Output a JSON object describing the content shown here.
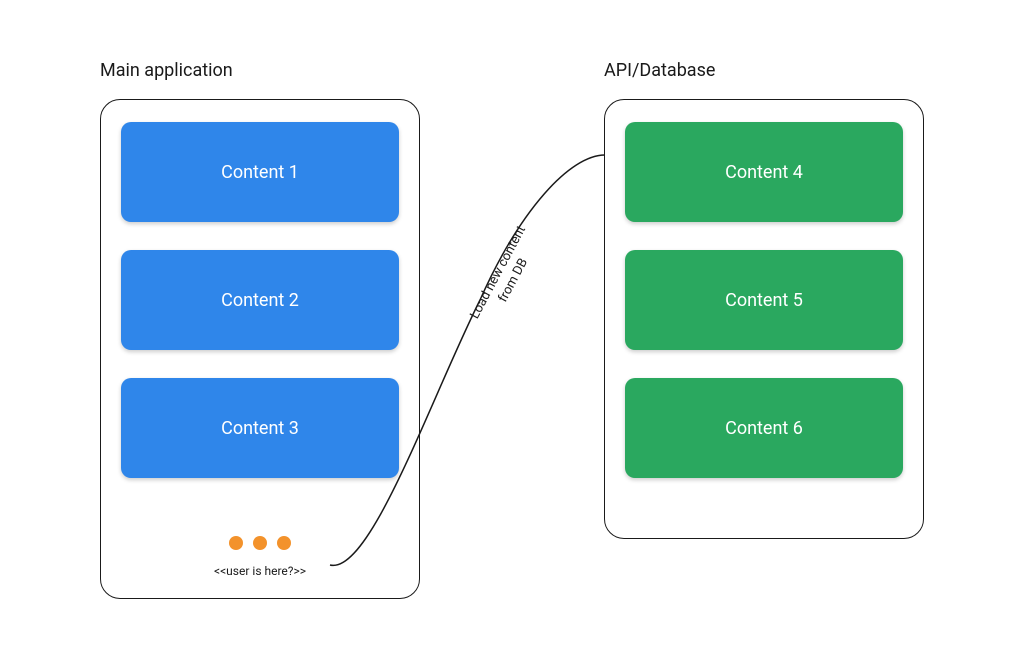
{
  "left": {
    "title": "Main application",
    "cards": [
      "Content 1",
      "Content 2",
      "Content 3"
    ],
    "user_marker": "<<user is here?>>"
  },
  "right": {
    "title": "API/Database",
    "cards": [
      "Content 4",
      "Content 5",
      "Content 6"
    ]
  },
  "connector": {
    "label_line1": "Load new content",
    "label_line2": "from DB"
  },
  "colors": {
    "blue": "#2f86ea",
    "green": "#2aa85f",
    "orange": "#f3922b"
  }
}
